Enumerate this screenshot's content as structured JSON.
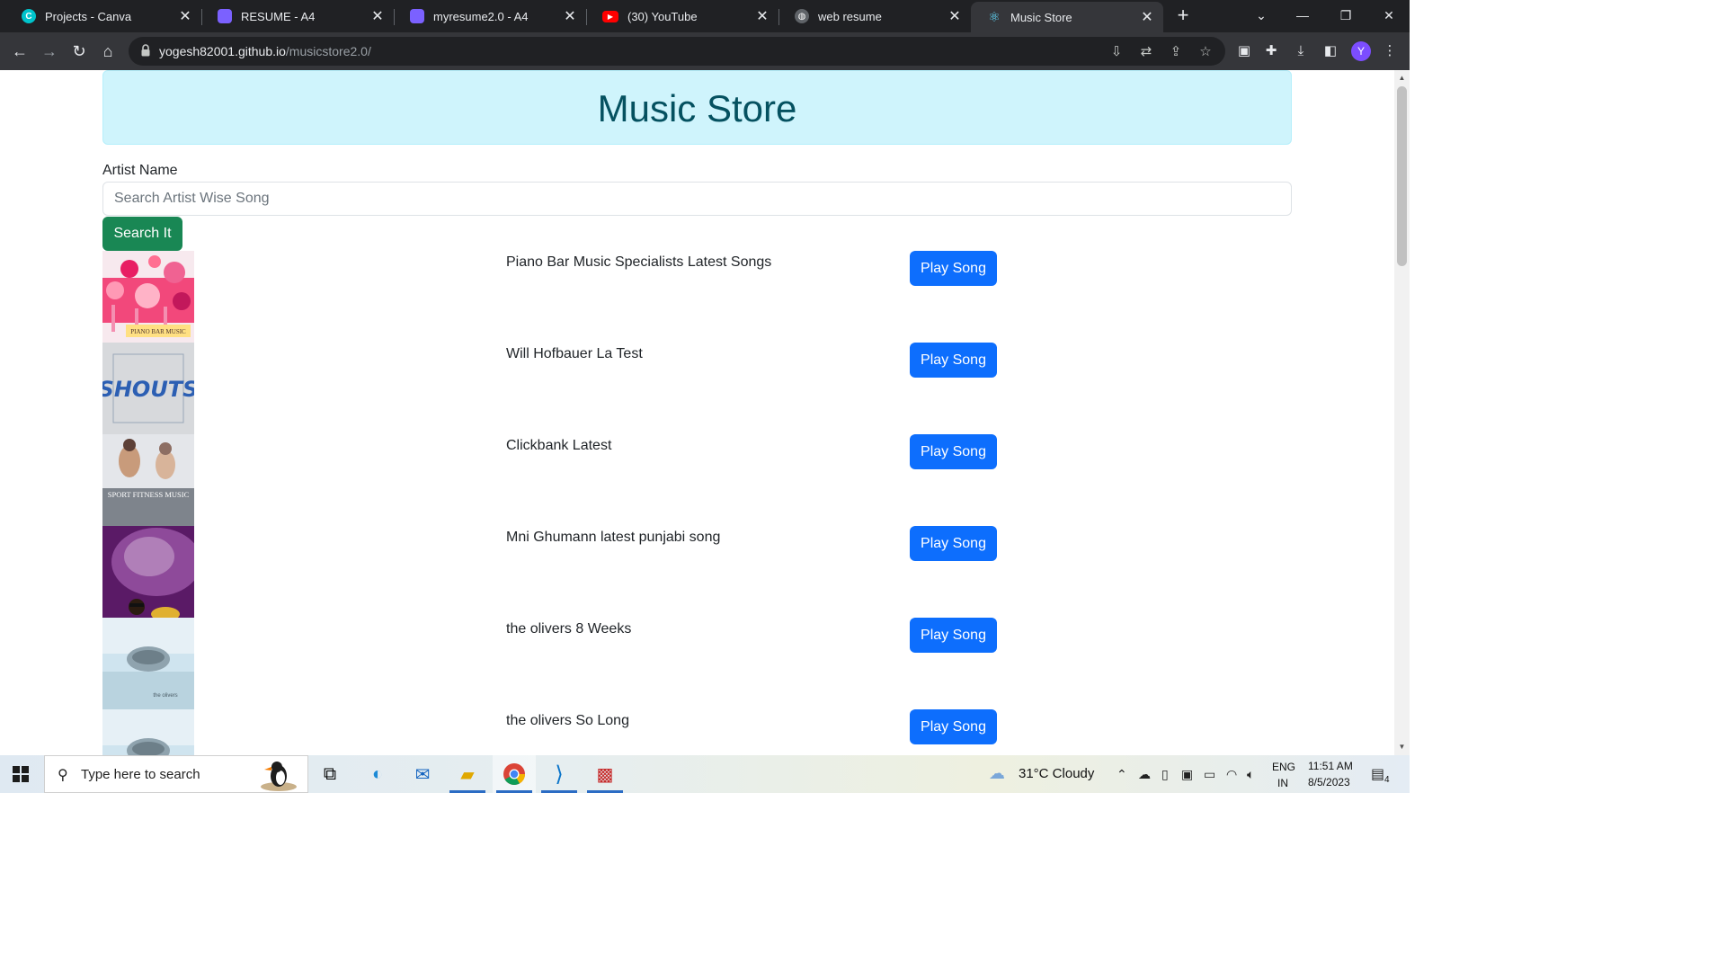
{
  "browser": {
    "tabs": [
      {
        "label": "Projects - Canva",
        "icon": "canva-icon",
        "color": "#00c4cc",
        "active": false
      },
      {
        "label": "RESUME - A4",
        "icon": "document-icon",
        "color": "#7b61ff",
        "active": false
      },
      {
        "label": "myresume2.0 - A4",
        "icon": "document-icon",
        "color": "#7b61ff",
        "active": false
      },
      {
        "label": "(30) YouTube",
        "icon": "youtube-icon",
        "color": "#ff0000",
        "active": false
      },
      {
        "label": "web resume",
        "icon": "globe-icon",
        "color": "#9aa0a6",
        "active": false
      },
      {
        "label": "Music Store",
        "icon": "react-icon",
        "color": "#61dafb",
        "active": true
      }
    ],
    "url_host": "yogesh82001.github.io",
    "url_path": "/musicstore2.0/",
    "profile_initial": "Y"
  },
  "page": {
    "title": "Music Store",
    "form_label": "Artist Name",
    "search_placeholder": "Search Artist Wise Song",
    "search_button": "Search It",
    "songs": [
      {
        "title": "Piano Bar Music Specialists Latest Songs",
        "button": "Play Song",
        "thumb": "piano-bar-cover",
        "thumb_text": "PIANO BAR MUSIC"
      },
      {
        "title": "Will Hofbauer La Test",
        "button": "Play Song",
        "thumb": "shouts-cover",
        "thumb_text": "SHOUTS"
      },
      {
        "title": "Clickbank Latest",
        "button": "Play Song",
        "thumb": "fitness-cover",
        "thumb_text": "SPORT FITNESS MUSIC"
      },
      {
        "title": "Mni Ghumann latest punjabi song",
        "button": "Play Song",
        "thumb": "portrait-cover",
        "thumb_text": ""
      },
      {
        "title": "the olivers 8 Weeks",
        "button": "Play Song",
        "thumb": "olivers-cover",
        "thumb_text": "the olivers"
      },
      {
        "title": "the olivers So Long",
        "button": "Play Song",
        "thumb": "olivers-cover-2",
        "thumb_text": ""
      }
    ]
  },
  "taskbar": {
    "search_placeholder": "Type here to search",
    "weather": "31°C  Cloudy",
    "lang_top": "ENG",
    "lang_bottom": "IN",
    "time": "11:51 AM",
    "date": "8/5/2023",
    "notification_count": "4"
  },
  "colors": {
    "header_bg": "#cff4fc",
    "header_text": "#055160",
    "search_button": "#198754",
    "play_button": "#0d6efd"
  }
}
